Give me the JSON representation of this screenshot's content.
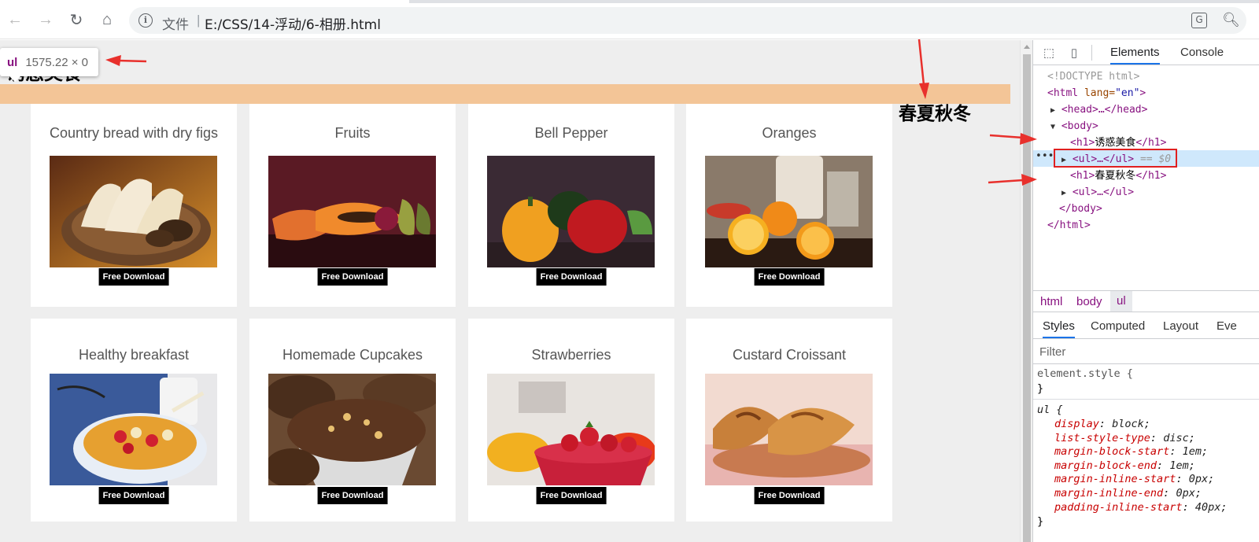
{
  "browser": {
    "scheme_label": "文件",
    "separator": "|",
    "url": "E:/CSS/14-浮动/6-相册.html",
    "translate_icon_text": "G"
  },
  "page": {
    "heading_1": "诱惑美食",
    "heading_2": "春夏秋冬",
    "tooltip": {
      "tag": "ul",
      "dims": "1575.22 × 0"
    },
    "download_label": "Free Download",
    "cards": [
      {
        "title": "Country bread with dry figs",
        "image": "bread-basket"
      },
      {
        "title": "Fruits",
        "image": "papaya-fruits"
      },
      {
        "title": "Bell Pepper",
        "image": "bell-peppers"
      },
      {
        "title": "Oranges",
        "image": "oranges"
      },
      {
        "title": "Healthy breakfast",
        "image": "cereal-bowl"
      },
      {
        "title": "Homemade Cupcakes",
        "image": "cupcakes"
      },
      {
        "title": "Strawberries",
        "image": "strawberries"
      },
      {
        "title": "Custard Croissant",
        "image": "croissants"
      }
    ]
  },
  "devtools": {
    "tabs": [
      "Elements",
      "Console"
    ],
    "active_tab": "Elements",
    "dom": {
      "doctype": "<!DOCTYPE html>",
      "html_open_tag": "<html",
      "html_attr": " lang=",
      "html_attr_val": "\"en\"",
      "html_open_end": ">",
      "head": "<head>…</head>",
      "body_open": "<body>",
      "h1_1_open": "<h1>",
      "h1_1_text": "诱惑美食",
      "h1_1_close": "</h1>",
      "ul_selected": "<ul>…</ul>",
      "selected_marker": " == $0",
      "h1_2_open": "<h1>",
      "h1_2_text": "春夏秋冬",
      "h1_2_close": "</h1>",
      "ul_2": "<ul>…</ul>",
      "body_close": "</body>",
      "html_close": "</html>",
      "dots": "•••"
    },
    "breadcrumbs": [
      "html",
      "body",
      "ul"
    ],
    "styles_tabs": [
      "Styles",
      "Computed",
      "Layout",
      "Eve"
    ],
    "filter_placeholder": "Filter",
    "element_style_selector": "element.style {",
    "close_brace": "}",
    "ul_selector": "ul {",
    "ul_rules": [
      {
        "prop": "display",
        "value": "block;"
      },
      {
        "prop": "list-style-type",
        "value": "disc;"
      },
      {
        "prop": "margin-block-start",
        "value": "1em;"
      },
      {
        "prop": "margin-block-end",
        "value": "1em;"
      },
      {
        "prop": "margin-inline-start",
        "value": "0px;"
      },
      {
        "prop": "margin-inline-end",
        "value": "0px;"
      },
      {
        "prop": "padding-inline-start",
        "value": "40px;"
      }
    ]
  },
  "colors": {
    "ul_highlight": "#f3c597",
    "annotation_red": "#e8302c",
    "selected_row": "#cfe8fc"
  }
}
